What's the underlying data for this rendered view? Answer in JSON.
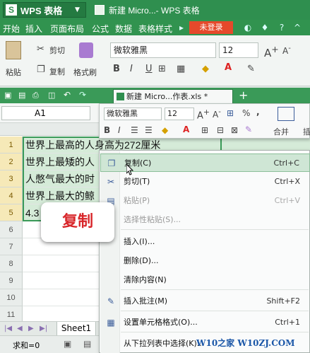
{
  "app": {
    "name": "WPS 表格",
    "window_title": "新建 Micro...- WPS 表格",
    "logo_letter": "S"
  },
  "menubar": {
    "items": [
      "开始",
      "插入",
      "页面布局",
      "公式",
      "数据",
      "表格样式"
    ],
    "login": "未登录"
  },
  "ribbon": {
    "paste": "粘贴",
    "cut": "剪切",
    "copy": "复制",
    "format_painter": "格式刷",
    "font": "微软雅黑",
    "size": "12",
    "bold": "B",
    "italic": "I",
    "underline": "U"
  },
  "tabbar": {
    "doc_tab": "新建 Micro...作表.xls *"
  },
  "formulabar": {
    "namebox": "A1"
  },
  "minitoolbar": {
    "font": "微软雅黑",
    "size": "12",
    "percent": "%",
    "merge": "合并",
    "insert": "插"
  },
  "grid": {
    "rows": [
      {
        "num": "1",
        "text": "世界上最高的人身高为272厘米"
      },
      {
        "num": "2",
        "text": "世界上最矮的人"
      },
      {
        "num": "3",
        "text": "人憋气最大的时"
      },
      {
        "num": "4",
        "text": "世界上最大的鲸"
      },
      {
        "num": "5",
        "text": "4.3"
      },
      {
        "num": "6",
        "text": ""
      },
      {
        "num": "7",
        "text": ""
      },
      {
        "num": "8",
        "text": ""
      },
      {
        "num": "9",
        "text": ""
      },
      {
        "num": "10",
        "text": ""
      },
      {
        "num": "11",
        "text": ""
      }
    ]
  },
  "sheetbar": {
    "sheet": "Sheet1"
  },
  "status": {
    "sum": "求和=0"
  },
  "context_menu": {
    "items": [
      {
        "label": "复制(C)",
        "shortcut": "Ctrl+C",
        "icon": "copy-icon"
      },
      {
        "label": "剪切(T)",
        "shortcut": "Ctrl+X",
        "icon": "scissors-icon"
      },
      {
        "label": "粘贴(P)",
        "shortcut": "Ctrl+V",
        "icon": "paste-icon"
      },
      {
        "label": "选择性粘贴(S)...",
        "shortcut": "",
        "icon": ""
      },
      {
        "label": "插入(I)...",
        "shortcut": "",
        "icon": ""
      },
      {
        "label": "删除(D)...",
        "shortcut": "",
        "icon": ""
      },
      {
        "label": "清除内容(N)",
        "shortcut": "",
        "icon": ""
      },
      {
        "label": "插入批注(M)",
        "shortcut": "Shift+F2",
        "icon": "comment-icon"
      },
      {
        "label": "设置单元格格式(O)...",
        "shortcut": "Ctrl+1",
        "icon": "format-cells-icon"
      },
      {
        "label": "从下拉列表中选择(K)...",
        "shortcut": "",
        "icon": ""
      }
    ]
  },
  "overlay": {
    "label": "复制"
  },
  "watermark": {
    "text": "W10之家 W10ZJ.COM"
  },
  "colors": {
    "accent": "#2f8f4f",
    "login": "#e5492b",
    "overlay_text": "#d8262a",
    "highlight": "#cfe6d5"
  }
}
